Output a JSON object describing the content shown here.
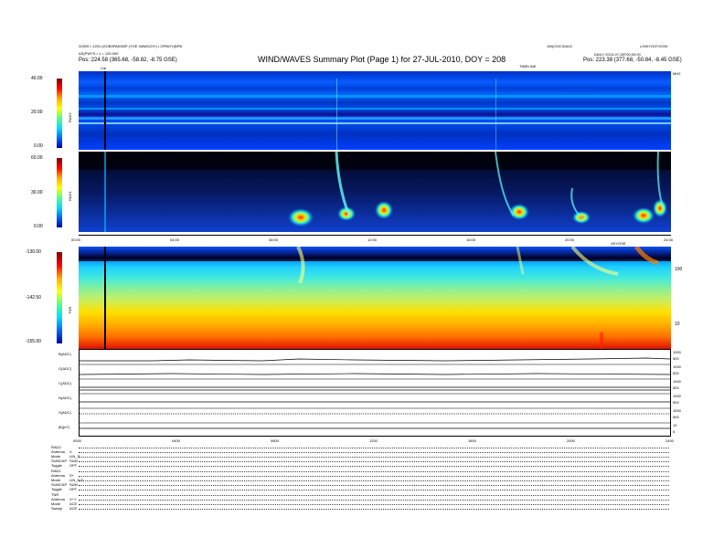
{
  "header": {
    "title": "WIND/WAVES Summary Plot (Page 1) for 27-JUL-2010, DOY = 208",
    "left_line1": "GOBS • 1201 (GOB3PAKDBP (YGE 3IAWOZIY) • OPBOY(BPB",
    "left_line2": "AS(PWYS • 1 = 120.000",
    "left_pos": "Pos:   224.58 (365.68, -58.82, -8.75 GSE)",
    "left_mark": "Cal",
    "right_line1": "1W(OOCS/ALD",
    "right_line2": "LOWYOOYVODI",
    "right_line3": "DAILY  2010-07-28T00:00:00",
    "right_pos": "Pos:   223.38 (377.68, -50.84, -8.45 GSE)",
    "top_mid_label": "TIMELINE",
    "top_right_label": "MH2"
  },
  "panels": {
    "rad2_label": "RAD2",
    "rad1_label": "RAD1",
    "tnr_label": "TNR",
    "rad2_ticks": [
      "40.00",
      "20.00",
      "0.00"
    ],
    "rad1_ticks": [
      "60.00",
      "30.00",
      "0.00"
    ],
    "tnr_ticks": [
      "-130.00",
      "-142.50",
      "-155.00"
    ],
    "tnr_right_ticks": [
      "100",
      "10"
    ],
    "tnr_right_label": "XKYOSE"
  },
  "time_axis_upper": [
    "00:00",
    "04:00",
    "08:00",
    "12:00",
    "16:00",
    "20:00",
    "24:00"
  ],
  "time_axis_lower": [
    "0000",
    "0400",
    "0800",
    "1200",
    "1600",
    "2000",
    "2400"
  ],
  "lines": [
    {
      "label": "B(ADC)",
      "right": [
        "1000",
        "500"
      ]
    },
    {
      "label": "G(ADC)",
      "right": [
        "1000",
        "500"
      ]
    },
    {
      "label": "C(ADC)",
      "right": [
        "1000",
        "500"
      ]
    },
    {
      "label": "N(ADC)",
      "right": [
        "1000",
        "500"
      ]
    },
    {
      "label": "X(ADC)",
      "right": [
        "1000",
        "500"
      ]
    },
    {
      "label": "|B|(nT)",
      "right": [
        "10",
        "5"
      ]
    }
  ],
  "bottom_table": [
    {
      "label": "RAD2",
      "value": ""
    },
    {
      "label": "Antenna",
      "value": "X"
    },
    {
      "label": "Mode",
      "value": "LIN_S"
    },
    {
      "label": "SUMCAP",
      "value": "SUM"
    },
    {
      "label": "Toggle",
      "value": "OFF"
    },
    {
      "label": "RAD1",
      "value": ""
    },
    {
      "label": "Antenna",
      "value": "S+"
    },
    {
      "label": "Mode",
      "value": "LIN_D,E"
    },
    {
      "label": "SUMCAP",
      "value": "SUM"
    },
    {
      "label": "Toggle",
      "value": "OFF"
    },
    {
      "label": "TNR",
      "value": ""
    },
    {
      "label": "Antenna",
      "value": "X+Y"
    },
    {
      "label": "Mode",
      "value": "ACE"
    },
    {
      "label": "Sweep",
      "value": "ACE"
    }
  ],
  "chart_data": {
    "type": "heatmap",
    "title": "WIND/WAVES Summary Plot (Page 1) for 27-JUL-2010, DOY = 208",
    "x_axis": [
      "00:00",
      "04:00",
      "08:00",
      "12:00",
      "16:00",
      "20:00",
      "24:00"
    ],
    "panels": [
      {
        "name": "RAD2",
        "ylim": [
          0,
          40
        ],
        "ticks": [
          0,
          20,
          40
        ]
      },
      {
        "name": "RAD1",
        "ylim": [
          0,
          60
        ],
        "ticks": [
          0,
          30,
          60
        ]
      },
      {
        "name": "TNR",
        "ylim": [
          -155,
          -130
        ],
        "ticks": [
          -155,
          -142.5,
          -130
        ]
      }
    ],
    "burst_times_hours": [
      1.0,
      7.8,
      9.0,
      10.2,
      12.0,
      18.0,
      20.2,
      22.0,
      23.2
    ],
    "colors": {
      "low": "#0000aa",
      "mid": "#00ddff",
      "high": "#ffff00",
      "peak": "#ff0000"
    }
  }
}
